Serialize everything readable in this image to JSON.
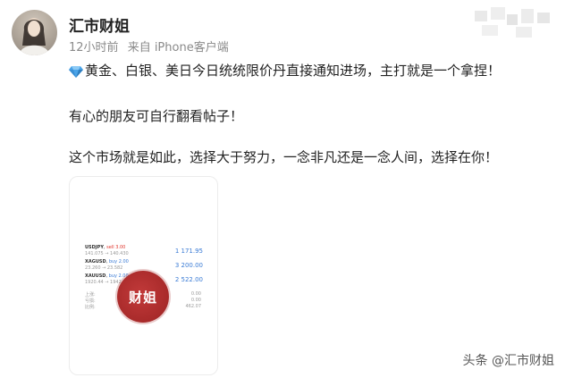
{
  "post": {
    "author": "汇市财姐",
    "meta_time": "12小时前",
    "meta_source": "来自 iPhone客户端",
    "lines": [
      "黄金、白银、美日今日统统限价丹直接通知进场，主打就是一个拿捏！",
      "有心的朋友可自行翻看帖子！",
      "这个市场就是如此，选择大于努力，一念非凡还是一念人间，选择在你！"
    ]
  },
  "card": {
    "rows": [
      {
        "symbol": "USDJPY",
        "tag": "sell 3.00",
        "sub": "141.075 → 140.430",
        "value": "1 171.95"
      },
      {
        "symbol": "XAGUSD",
        "tag": "buy 2.00",
        "sub": "23.260 → 23.582",
        "value": "3 200.00"
      },
      {
        "symbol": "XAUUSD",
        "tag": "buy 2.00",
        "sub": "1920.44 → 1942.00",
        "value": "2 522.00"
      }
    ],
    "footer_labels": [
      "上涨:",
      "亏损:",
      "比例:"
    ],
    "footer_values": [
      "0.00",
      "0.00",
      "462.07"
    ],
    "stamp_text": "财姐"
  },
  "watermark": "头条 @汇市财姐",
  "colors": {
    "gem": "#4aa3e8",
    "stamp": "#a82a2a",
    "value": "#3a7bd5",
    "tag": "#e0342b"
  }
}
